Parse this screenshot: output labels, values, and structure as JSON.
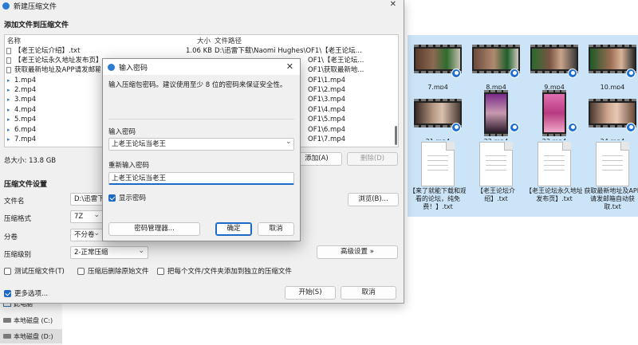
{
  "main_window": {
    "title": "新建压缩文件",
    "close_glyph": "✕",
    "add_section_title": "添加文件到压缩文件",
    "columns": {
      "name": "名称",
      "size": "大小",
      "path": "文件路径"
    },
    "files": [
      {
        "name": "【老王论坛介绍】.txt",
        "size": "1.06 KB",
        "path": "D:\\迅雷下载\\Naomi Hughes\\OF1\\【老王论坛..."
      },
      {
        "name": "【老王论坛永久地址发布页】.txt",
        "size": "",
        "path": "OF1\\【老王论坛..."
      },
      {
        "name": "获取最新地址及APP请发邮箱自...",
        "size": "",
        "path": "OF1\\获取最新地..."
      },
      {
        "name": "1.mp4",
        "size": "",
        "path": "OF1\\1.mp4"
      },
      {
        "name": "2.mp4",
        "size": "",
        "path": "OF1\\2.mp4"
      },
      {
        "name": "3.mp4",
        "size": "",
        "path": "OF1\\3.mp4"
      },
      {
        "name": "4.mp4",
        "size": "",
        "path": "OF1\\4.mp4"
      },
      {
        "name": "5.mp4",
        "size": "",
        "path": "OF1\\5.mp4"
      },
      {
        "name": "6.mp4",
        "size": "",
        "path": "OF1\\6.mp4"
      },
      {
        "name": "7.mp4",
        "size": "",
        "path": "OF1\\7.mp4"
      }
    ],
    "total_size": "总大小: 13.8 GB",
    "add_button": "添加(A)",
    "delete_button": "删除(D)",
    "settings_title": "压缩文件设置",
    "filename_label": "文件名",
    "filename_value": "D:\\迅雷下",
    "browse_button": "浏览(B)...",
    "format_label": "压缩格式",
    "format_value": "7Z",
    "split_label": "分卷",
    "split_value": "不分卷",
    "level_label": "压缩级别",
    "level_value": "2-正常压缩",
    "advanced_button": "高级设置 »",
    "opt_test": "测试压缩文件(T)",
    "opt_delete": "压缩后删除原始文件",
    "opt_separate": "把每个文件/文件夹添加到独立的压缩文件",
    "more_options": "更多选项...",
    "start_button": "开始(S)",
    "cancel_button": "取消"
  },
  "nav": {
    "this_pc": "此电脑",
    "drive_c": "本地磁盘 (C:)",
    "drive_d": "本地磁盘 (D:)"
  },
  "files_grid": {
    "videos": [
      "7.mp4",
      "8.mp4",
      "9.mp4",
      "10.mp4",
      "21.mp4",
      "22.mp4",
      "23.mp4",
      "24.mp4"
    ],
    "docs": [
      "【来了就能下载和观看的论坛，纯免费！】.txt",
      "【老王论坛介绍】.txt",
      "【老王论坛永久地址发布页】.txt",
      "获取最新地址及APP请发邮箱自动获取.txt"
    ]
  },
  "password_dialog": {
    "title": "输入密码",
    "close_glyph": "✕",
    "hint": "输入压缩包密码。建议使用至少 8 位的密码来保证安全性。",
    "password_label": "输入密码",
    "password_value": "上老王论坛当老王",
    "confirm_label": "重新输入密码",
    "confirm_value": "上老王论坛当老王",
    "show_password": "显示密码",
    "manager_button": "密码管理器...",
    "ok_button": "确定",
    "cancel_button": "取消"
  },
  "colors": {
    "accent": "#1c6ac7",
    "badge": "#1e6fd6"
  }
}
